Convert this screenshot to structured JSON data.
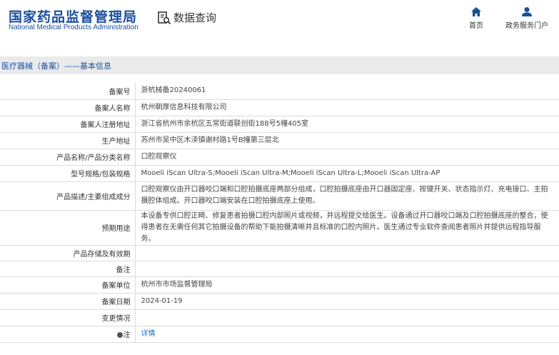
{
  "header": {
    "logo_cn": "国家药品监督管理局",
    "logo_en": "National Medical Products Administration",
    "query_title": "数据查询",
    "nav": {
      "home_label": "首页",
      "portal_label": "政务服务门户"
    }
  },
  "breadcrumb": "医疗器械（备案）——基本信息",
  "colors": {
    "brand": "#1a4f9c",
    "link": "#1a6fd1",
    "crumb_bg": "#eaeaea",
    "border": "#dcdcdc"
  },
  "rows": [
    {
      "label": "备案号",
      "value": "浙杭械备20240061"
    },
    {
      "label": "备案人名称",
      "value": "杭州朝厚信息科技有限公司"
    },
    {
      "label": "备案人注册地址",
      "value": "浙江省杭州市余杭区五常街道联创街188号5幢405室"
    },
    {
      "label": "生产地址",
      "value": "苏州市吴中区木渎镇谢村路1号B幢第三层北"
    },
    {
      "label": "产品名称/产品分类名称",
      "value": "口腔观察仪"
    },
    {
      "label": "型号规格/包装规格",
      "value": "Mooeli iScan Ultra-S;Mooeli iScan Ultra-M;Mooeli iScan Ultra-L;Mooeli iScan Ultra-AP"
    },
    {
      "label": "产品描述/主要组成成分",
      "value": "口腔观察仪由开口器咬口端和口腔拍摄底座两部分组成，口腔拍摄底座由开口器固定座、按键开关、状态指示灯、充电接口、主拍摄腔体组成。开口器咬口端安装在口腔拍摄底座上使用。"
    },
    {
      "label": "预期用途",
      "value": "本设备专供口腔正畸、修复患者拍摄口腔内部照片或视频，并远程提交给医生。设备通过开口器咬口端及口腔拍摄底座的整合，使得患者在无需任何其它拍摄设备的帮助下能拍摄清晰并且标准的口腔内照片。医生通过专业软件查阅患者照片并提供远程指导服务。"
    },
    {
      "label": "产品存储及有效期",
      "value": ""
    },
    {
      "label": "备注",
      "value": ""
    },
    {
      "label": "备案单位",
      "value": "杭州市市场监督管理局"
    },
    {
      "label": "备案日期",
      "value": "2024-01-19"
    },
    {
      "label": "变更情况",
      "value": ""
    },
    {
      "label": "注",
      "value": "详情"
    }
  ]
}
